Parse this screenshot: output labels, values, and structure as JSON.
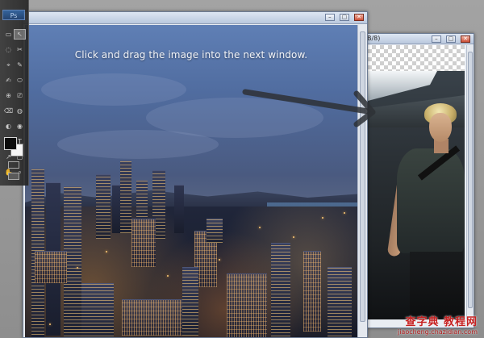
{
  "app": {
    "logo_text": "Ps"
  },
  "tools": {
    "glyphs": [
      "▭",
      "↖",
      "◌",
      "✂",
      "⌖",
      "✎",
      "✍",
      "⬭",
      "⊕",
      "⎚",
      "⌫",
      "◍",
      "◐",
      "◉",
      "✒",
      "T",
      "↗",
      "▢",
      "✋",
      "⌕"
    ]
  },
  "main_window": {
    "instruction_text": "Click and drag the image into the next window.",
    "buttons": {
      "minimize": "–",
      "maximize": "▢",
      "close": "✕"
    }
  },
  "second_window": {
    "title_fragment": "B/8)",
    "buttons": {
      "minimize": "–",
      "maximize": "▢",
      "close": "✕"
    }
  },
  "watermark": {
    "main": "查字典 教程网",
    "sub": "jiaocheng.chazidian.com"
  }
}
